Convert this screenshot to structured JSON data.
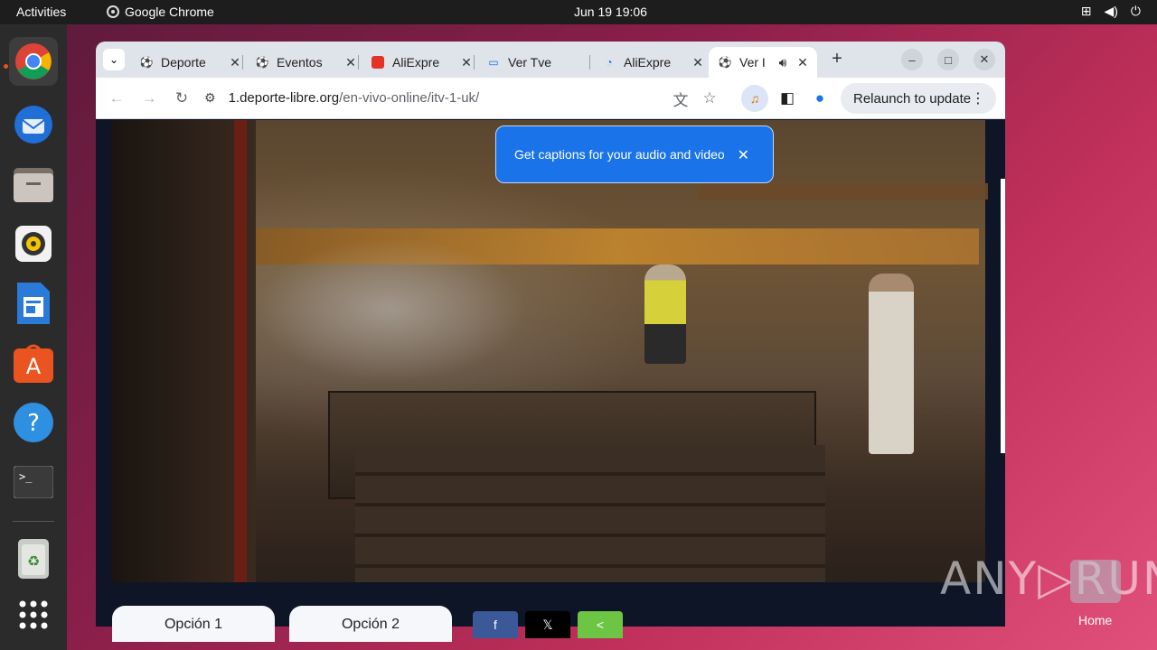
{
  "topbar": {
    "activities": "Activities",
    "app_name": "Google Chrome",
    "clock": "Jun 19  19:06"
  },
  "dock": {
    "items": [
      "chrome",
      "thunderbird",
      "files",
      "rhythmbox",
      "writer",
      "app-center",
      "help",
      "terminal",
      "trash",
      "show-apps"
    ]
  },
  "tabs": [
    {
      "label": "Deporte",
      "icon": "soccer-ball-icon"
    },
    {
      "label": "Eventos",
      "icon": "soccer-ball-icon"
    },
    {
      "label": "AliExpre",
      "icon": "aliexpress-icon"
    },
    {
      "label": "Ver Tve",
      "icon": "tv-icon"
    },
    {
      "label": "AliExpre",
      "icon": "aliexpress-loading-icon"
    },
    {
      "label": "Ver I",
      "icon": "soccer-ball-icon",
      "active": true
    }
  ],
  "toolbar": {
    "url_domain": "1.deporte-libre.org",
    "url_path": "/en-vivo-online/itv-1-uk/",
    "relaunch": "Relaunch to update"
  },
  "captions_popup": {
    "text": "Get captions for your audio and video"
  },
  "page": {
    "option1": "Opción 1",
    "option2": "Opción 2",
    "share_facebook": "f",
    "share_x": "𝕏",
    "share_generic": "<"
  },
  "desktop": {
    "watermark": "ANY▷RUN",
    "home_label": "Home"
  },
  "colors": {
    "accent": "#1a73e8",
    "facebook": "#3b5998",
    "x": "#000000",
    "share": "#6cc644"
  }
}
